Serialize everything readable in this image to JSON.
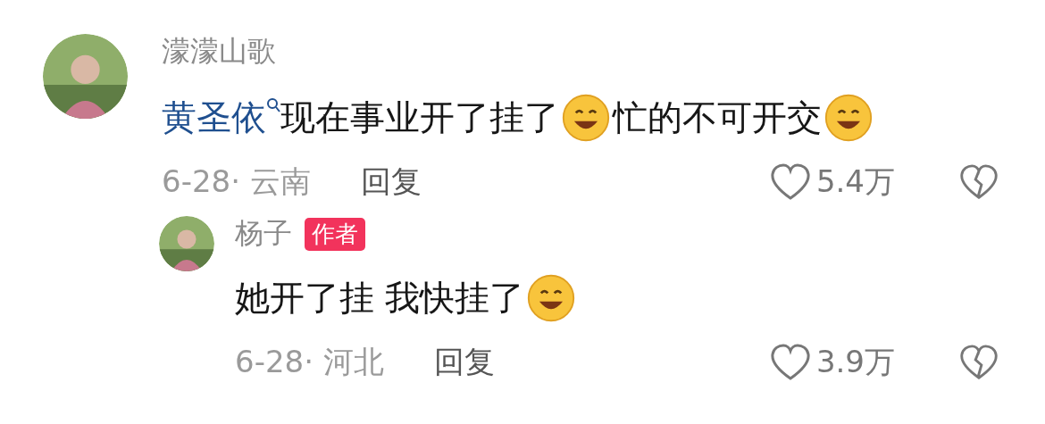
{
  "comments": [
    {
      "author": "濛濛山歌",
      "content": [
        {
          "kind": "mention",
          "text": "黄圣依"
        },
        {
          "kind": "text",
          "text": "现在事业开了挂了"
        },
        {
          "kind": "emoji"
        },
        {
          "kind": "text",
          "text": "忙的不可开交"
        },
        {
          "kind": "emoji"
        }
      ],
      "date": "6-28· 云南",
      "reply_label": "回复",
      "likes": "5.4万",
      "replies": [
        {
          "author": "杨子",
          "badge": "作者",
          "content": [
            {
              "kind": "text",
              "text": "她开了挂 我快挂了"
            },
            {
              "kind": "emoji"
            }
          ],
          "date": "6-28· 河北",
          "reply_label": "回复",
          "likes": "3.9万"
        }
      ]
    }
  ]
}
